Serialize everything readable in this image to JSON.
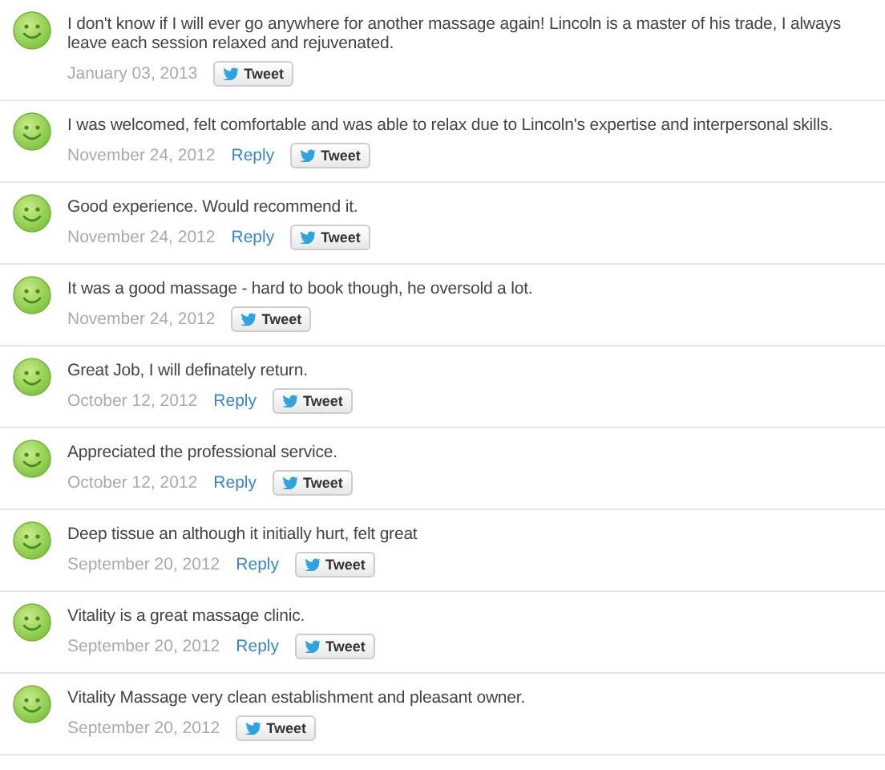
{
  "reviews": [
    {
      "text": "I don't know if I will ever go anywhere for another massage again! Lincoln is a master of his trade, I always leave each session relaxed and rejuvenated.",
      "date": "January 03, 2013",
      "tweet": "Tweet"
    },
    {
      "text": "I was welcomed, felt comfortable and was able to relax due to Lincoln's expertise and interpersonal skills.",
      "date": "November 24, 2012",
      "reply": "Reply",
      "tweet": "Tweet"
    },
    {
      "text": "Good experience. Would recommend it.",
      "date": "November 24, 2012",
      "reply": "Reply",
      "tweet": "Tweet"
    },
    {
      "text": "It was a good massage - hard to book though, he oversold a lot.",
      "date": "November 24, 2012",
      "tweet": "Tweet"
    },
    {
      "text": "Great Job, I will definately return.",
      "date": "October 12, 2012",
      "reply": "Reply",
      "tweet": "Tweet"
    },
    {
      "text": "Appreciated the professional service.",
      "date": "October 12, 2012",
      "reply": "Reply",
      "tweet": "Tweet"
    },
    {
      "text": "Deep tissue an although it initially hurt, felt great",
      "date": "September 20, 2012",
      "reply": "Reply",
      "tweet": "Tweet"
    },
    {
      "text": "Vitality is a great massage clinic.",
      "date": "September 20, 2012",
      "reply": "Reply",
      "tweet": "Tweet"
    },
    {
      "text": "Vitality Massage very clean establishment and pleasant owner.",
      "date": "September 20, 2012",
      "tweet": "Tweet"
    }
  ]
}
